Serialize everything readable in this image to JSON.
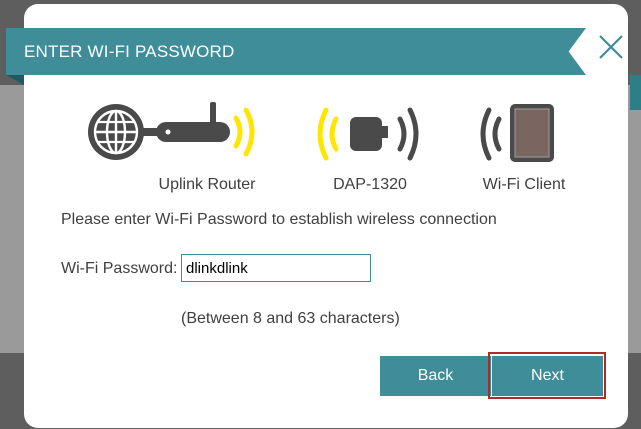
{
  "dialog": {
    "title": "ENTER WI-FI PASSWORD",
    "close_icon": "close-icon"
  },
  "devices": [
    {
      "label": "Uplink Router",
      "icon": "router-globe-icon"
    },
    {
      "label": "DAP-1320",
      "icon": "extender-plug-icon"
    },
    {
      "label": "Wi-Fi Client",
      "icon": "tablet-client-icon"
    }
  ],
  "instruction": "Please enter Wi-Fi Password to establish wireless connection",
  "password": {
    "label": "Wi-Fi Password:",
    "value": "dlinkdlink",
    "hint": "(Between 8 and 63 characters)"
  },
  "buttons": {
    "back": "Back",
    "next": "Next"
  },
  "colors": {
    "accent": "#3e8d98",
    "signal": "#ffe600",
    "icon_dark": "#4a4a4a",
    "next_focus": "#b02a2a"
  }
}
